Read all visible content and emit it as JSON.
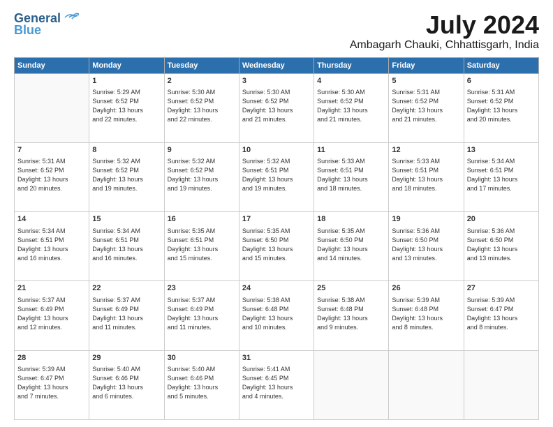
{
  "header": {
    "logo_line1": "General",
    "logo_line2": "Blue",
    "month_title": "July 2024",
    "location": "Ambagarh Chauki, Chhattisgarh, India"
  },
  "days_of_week": [
    "Sunday",
    "Monday",
    "Tuesday",
    "Wednesday",
    "Thursday",
    "Friday",
    "Saturday"
  ],
  "weeks": [
    [
      {
        "num": "",
        "info": ""
      },
      {
        "num": "1",
        "info": "Sunrise: 5:29 AM\nSunset: 6:52 PM\nDaylight: 13 hours\nand 22 minutes."
      },
      {
        "num": "2",
        "info": "Sunrise: 5:30 AM\nSunset: 6:52 PM\nDaylight: 13 hours\nand 22 minutes."
      },
      {
        "num": "3",
        "info": "Sunrise: 5:30 AM\nSunset: 6:52 PM\nDaylight: 13 hours\nand 21 minutes."
      },
      {
        "num": "4",
        "info": "Sunrise: 5:30 AM\nSunset: 6:52 PM\nDaylight: 13 hours\nand 21 minutes."
      },
      {
        "num": "5",
        "info": "Sunrise: 5:31 AM\nSunset: 6:52 PM\nDaylight: 13 hours\nand 21 minutes."
      },
      {
        "num": "6",
        "info": "Sunrise: 5:31 AM\nSunset: 6:52 PM\nDaylight: 13 hours\nand 20 minutes."
      }
    ],
    [
      {
        "num": "7",
        "info": "Sunrise: 5:31 AM\nSunset: 6:52 PM\nDaylight: 13 hours\nand 20 minutes."
      },
      {
        "num": "8",
        "info": "Sunrise: 5:32 AM\nSunset: 6:52 PM\nDaylight: 13 hours\nand 19 minutes."
      },
      {
        "num": "9",
        "info": "Sunrise: 5:32 AM\nSunset: 6:52 PM\nDaylight: 13 hours\nand 19 minutes."
      },
      {
        "num": "10",
        "info": "Sunrise: 5:32 AM\nSunset: 6:51 PM\nDaylight: 13 hours\nand 19 minutes."
      },
      {
        "num": "11",
        "info": "Sunrise: 5:33 AM\nSunset: 6:51 PM\nDaylight: 13 hours\nand 18 minutes."
      },
      {
        "num": "12",
        "info": "Sunrise: 5:33 AM\nSunset: 6:51 PM\nDaylight: 13 hours\nand 18 minutes."
      },
      {
        "num": "13",
        "info": "Sunrise: 5:34 AM\nSunset: 6:51 PM\nDaylight: 13 hours\nand 17 minutes."
      }
    ],
    [
      {
        "num": "14",
        "info": "Sunrise: 5:34 AM\nSunset: 6:51 PM\nDaylight: 13 hours\nand 16 minutes."
      },
      {
        "num": "15",
        "info": "Sunrise: 5:34 AM\nSunset: 6:51 PM\nDaylight: 13 hours\nand 16 minutes."
      },
      {
        "num": "16",
        "info": "Sunrise: 5:35 AM\nSunset: 6:51 PM\nDaylight: 13 hours\nand 15 minutes."
      },
      {
        "num": "17",
        "info": "Sunrise: 5:35 AM\nSunset: 6:50 PM\nDaylight: 13 hours\nand 15 minutes."
      },
      {
        "num": "18",
        "info": "Sunrise: 5:35 AM\nSunset: 6:50 PM\nDaylight: 13 hours\nand 14 minutes."
      },
      {
        "num": "19",
        "info": "Sunrise: 5:36 AM\nSunset: 6:50 PM\nDaylight: 13 hours\nand 13 minutes."
      },
      {
        "num": "20",
        "info": "Sunrise: 5:36 AM\nSunset: 6:50 PM\nDaylight: 13 hours\nand 13 minutes."
      }
    ],
    [
      {
        "num": "21",
        "info": "Sunrise: 5:37 AM\nSunset: 6:49 PM\nDaylight: 13 hours\nand 12 minutes."
      },
      {
        "num": "22",
        "info": "Sunrise: 5:37 AM\nSunset: 6:49 PM\nDaylight: 13 hours\nand 11 minutes."
      },
      {
        "num": "23",
        "info": "Sunrise: 5:37 AM\nSunset: 6:49 PM\nDaylight: 13 hours\nand 11 minutes."
      },
      {
        "num": "24",
        "info": "Sunrise: 5:38 AM\nSunset: 6:48 PM\nDaylight: 13 hours\nand 10 minutes."
      },
      {
        "num": "25",
        "info": "Sunrise: 5:38 AM\nSunset: 6:48 PM\nDaylight: 13 hours\nand 9 minutes."
      },
      {
        "num": "26",
        "info": "Sunrise: 5:39 AM\nSunset: 6:48 PM\nDaylight: 13 hours\nand 8 minutes."
      },
      {
        "num": "27",
        "info": "Sunrise: 5:39 AM\nSunset: 6:47 PM\nDaylight: 13 hours\nand 8 minutes."
      }
    ],
    [
      {
        "num": "28",
        "info": "Sunrise: 5:39 AM\nSunset: 6:47 PM\nDaylight: 13 hours\nand 7 minutes."
      },
      {
        "num": "29",
        "info": "Sunrise: 5:40 AM\nSunset: 6:46 PM\nDaylight: 13 hours\nand 6 minutes."
      },
      {
        "num": "30",
        "info": "Sunrise: 5:40 AM\nSunset: 6:46 PM\nDaylight: 13 hours\nand 5 minutes."
      },
      {
        "num": "31",
        "info": "Sunrise: 5:41 AM\nSunset: 6:45 PM\nDaylight: 13 hours\nand 4 minutes."
      },
      {
        "num": "",
        "info": ""
      },
      {
        "num": "",
        "info": ""
      },
      {
        "num": "",
        "info": ""
      }
    ]
  ]
}
